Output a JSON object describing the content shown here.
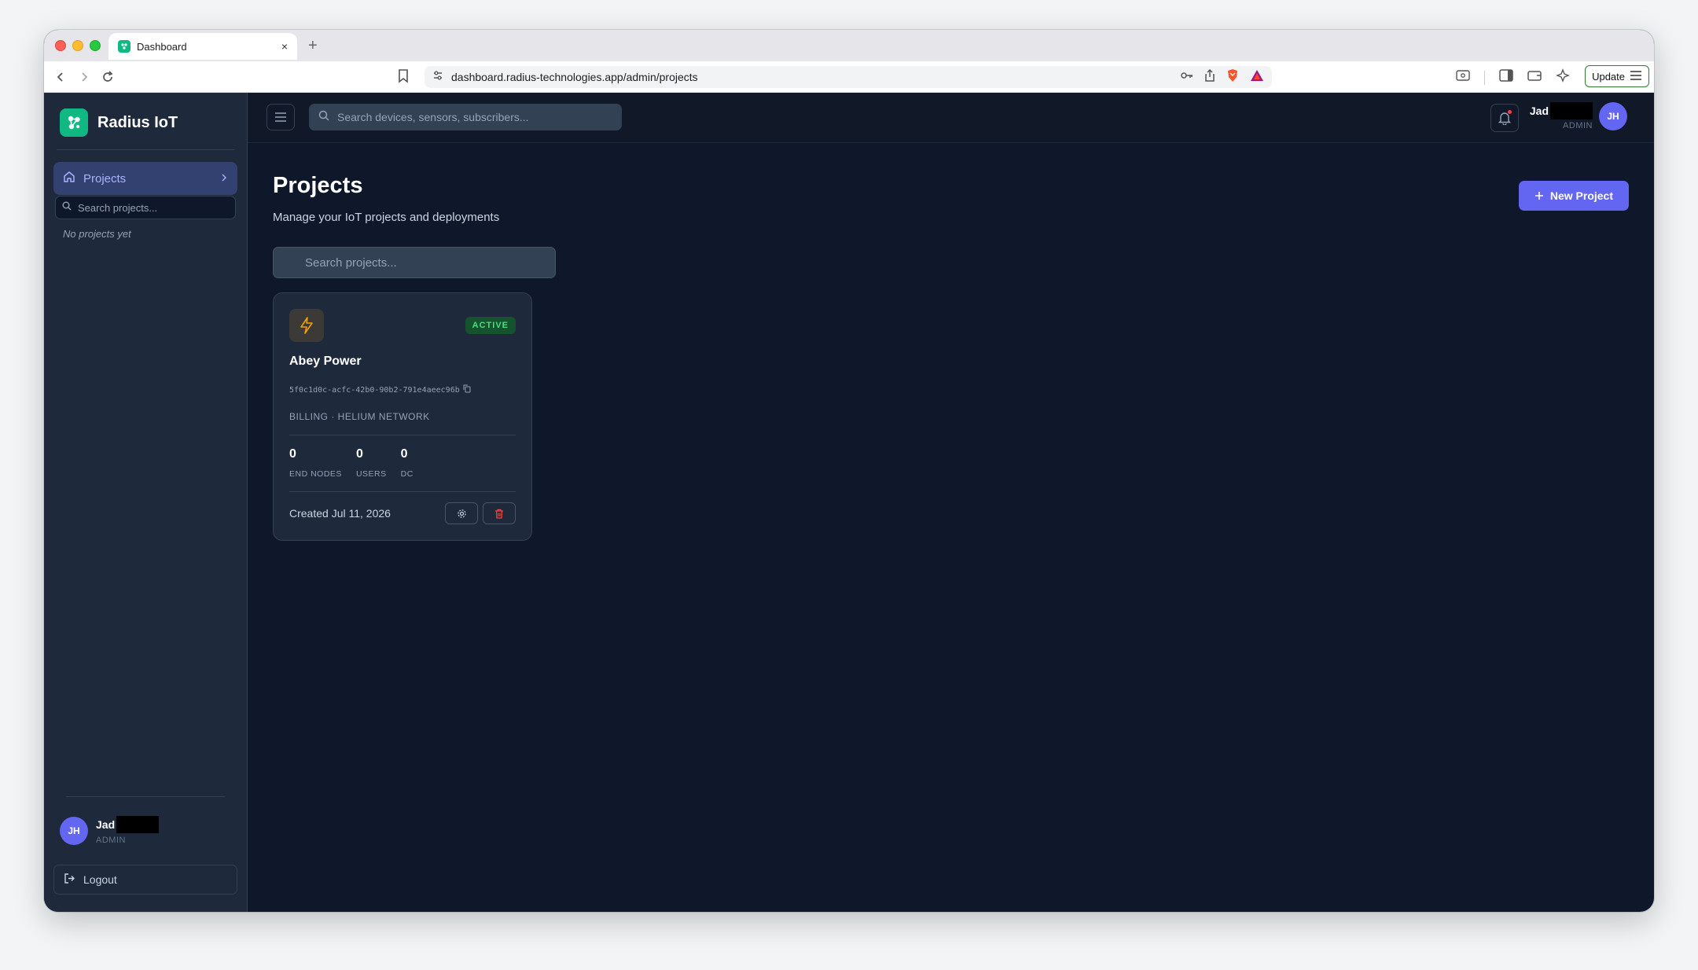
{
  "browser": {
    "tab_title": "Dashboard",
    "tab_close": "×",
    "new_tab": "+",
    "url": "dashboard.radius-technologies.app/admin/projects",
    "update_label": "Update"
  },
  "brand": {
    "name": "Radius IoT",
    "accent": "#10b981"
  },
  "sidebar": {
    "nav_projects_label": "Projects",
    "search_placeholder": "Search projects...",
    "empty_text": "No projects yet",
    "user": {
      "initials": "JH",
      "name": "Jad",
      "role": "ADMIN"
    },
    "logout_label": "Logout"
  },
  "topbar": {
    "search_placeholder": "Search devices, sensors, subscribers...",
    "user": {
      "initials": "JH",
      "name": "Jad",
      "role": "ADMIN"
    }
  },
  "page": {
    "title": "Projects",
    "subtitle": "Manage your IoT projects and deployments",
    "new_project_label": "New Project",
    "search_placeholder": "Search projects..."
  },
  "projects": [
    {
      "name": "Abey Power",
      "status": "ACTIVE",
      "id": "5f0c1d0c-acfc-42b0-90b2-791e4aeec96b",
      "billing": "BILLING · HELIUM NETWORK",
      "stats": [
        {
          "value": "0",
          "label": "END NODES"
        },
        {
          "value": "0",
          "label": "USERS"
        },
        {
          "value": "0",
          "label": "DC"
        }
      ],
      "created": "Created Jul 11, 2026"
    }
  ],
  "colors": {
    "primary": "#6366f1",
    "status_active": "#4ade80",
    "danger": "#ef4444",
    "bg": "#0f172a",
    "sidebar_bg": "#1e293b"
  }
}
